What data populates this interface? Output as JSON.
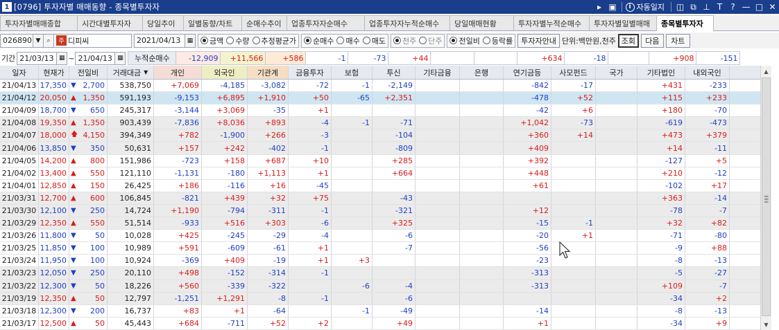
{
  "window": {
    "number": "1",
    "title": "[0796] 투자자별 매매동향 - 종목별투자자",
    "auto_label": "자동일지",
    "info_glyph": "i"
  },
  "tabs": [
    {
      "label": "투자자별매매종합",
      "active": false
    },
    {
      "label": "시간대별투자자",
      "active": false
    },
    {
      "label": "당일추이",
      "active": false
    },
    {
      "label": "일별동향/차트",
      "active": false
    },
    {
      "label": "순매수추이",
      "active": false
    },
    {
      "label": "업종투자자순매수",
      "active": false
    },
    {
      "label": "업종투자자누적순매수",
      "active": false
    },
    {
      "label": "당일매매현황",
      "active": false
    },
    {
      "label": "투자자별누적순매수",
      "active": false
    },
    {
      "label": "투자자별일별매매",
      "active": false
    },
    {
      "label": "종목별투자자",
      "active": true
    }
  ],
  "toolbar": {
    "stock_code": "026890",
    "stock_badge": "주",
    "stock_name": "디피씨",
    "date": "2021/04/13",
    "amount_options": [
      {
        "label": "금액",
        "checked": true
      },
      {
        "label": "수량",
        "checked": false
      },
      {
        "label": "추정평균가",
        "checked": false
      }
    ],
    "trade_options": [
      {
        "label": "순매수",
        "checked": true
      },
      {
        "label": "매수",
        "checked": false
      },
      {
        "label": "매도",
        "checked": false
      }
    ],
    "unit_options": [
      {
        "label": "천주",
        "checked": true
      },
      {
        "label": "단주",
        "checked": false
      }
    ],
    "compare_options": [
      {
        "label": "전일비",
        "checked": true
      },
      {
        "label": "등락률",
        "checked": false
      }
    ],
    "investor_guide_button": "투자자안내",
    "unit_text": "단위:백만원,천주",
    "query_button": "조회",
    "next_button": "다음",
    "chart_button": "차트"
  },
  "period": {
    "label": "기간",
    "from": "21/03/13",
    "tilde": "~",
    "to": "21/04/13",
    "cumulative_label": "누적순매수",
    "totals": [
      "-12,909",
      "+11,566",
      "+586",
      "-1",
      "-73",
      "+44",
      "",
      "",
      "+634",
      "-18",
      "",
      "+908",
      "-151"
    ]
  },
  "columns": [
    "일자",
    "현재가",
    "전일비",
    "거래대금",
    "개인",
    "외국인",
    "기관계",
    "금융투자",
    "보험",
    "투신",
    "기타금융",
    "은행",
    "연기금등",
    "사모펀드",
    "국가",
    "기타법인",
    "내외국인"
  ],
  "rows": [
    {
      "date": "21/04/13",
      "price": "17,350",
      "dir": "down",
      "diff": "2,700",
      "value": "538,750",
      "cells": [
        "+7,069",
        "-4,185",
        "-3,082",
        "-72",
        "-1",
        "-2,149",
        "",
        "",
        "-842",
        "-17",
        "",
        "+431",
        "-233"
      ],
      "bg": "white"
    },
    {
      "date": "21/04/12",
      "price": "20,050",
      "dir": "up",
      "diff": "1,350",
      "value": "591,193",
      "cells": [
        "-9,153",
        "+6,895",
        "+1,910",
        "+50",
        "-65",
        "+2,351",
        "",
        "",
        "-478",
        "+52",
        "",
        "+115",
        "+233"
      ],
      "bg": "sel"
    },
    {
      "date": "21/04/09",
      "price": "18,700",
      "dir": "down",
      "diff": "650",
      "value": "245,317",
      "cells": [
        "-3,144",
        "+3,069",
        "-35",
        "+1",
        "",
        "",
        "",
        "",
        "-42",
        "+6",
        "",
        "+180",
        "-70"
      ],
      "bg": "white"
    },
    {
      "date": "21/04/08",
      "price": "19,350",
      "dir": "up",
      "diff": "1,350",
      "value": "903,439",
      "cells": [
        "-7,836",
        "+8,036",
        "+893",
        "-4",
        "-1",
        "-71",
        "",
        "",
        "+1,042",
        "-73",
        "",
        "-619",
        "-473"
      ],
      "bg": "gray"
    },
    {
      "date": "21/04/07",
      "price": "18,000",
      "dir": "upper",
      "diff": "4,150",
      "value": "394,349",
      "cells": [
        "+782",
        "-1,900",
        "+266",
        "-3",
        "",
        "-104",
        "",
        "",
        "+360",
        "+14",
        "",
        "+473",
        "+379"
      ],
      "bg": "gray"
    },
    {
      "date": "21/04/06",
      "price": "13,850",
      "dir": "down",
      "diff": "350",
      "value": "50,631",
      "cells": [
        "+157",
        "+242",
        "-402",
        "-1",
        "",
        "-809",
        "",
        "",
        "+409",
        "",
        "",
        "+14",
        "-11"
      ],
      "bg": "gray"
    },
    {
      "date": "21/04/05",
      "price": "14,200",
      "dir": "up",
      "diff": "800",
      "value": "151,986",
      "cells": [
        "-723",
        "+158",
        "+687",
        "+10",
        "",
        "+285",
        "",
        "",
        "+392",
        "",
        "",
        "-127",
        "+5"
      ],
      "bg": "white"
    },
    {
      "date": "21/04/02",
      "price": "13,400",
      "dir": "up",
      "diff": "550",
      "value": "121,110",
      "cells": [
        "-1,131",
        "-180",
        "+1,113",
        "+1",
        "",
        "+664",
        "",
        "",
        "+448",
        "",
        "",
        "+210",
        "-12"
      ],
      "bg": "white"
    },
    {
      "date": "21/04/01",
      "price": "12,850",
      "dir": "up",
      "diff": "150",
      "value": "26,425",
      "cells": [
        "+186",
        "-116",
        "+16",
        "-45",
        "",
        "",
        "",
        "",
        "+61",
        "",
        "",
        "-102",
        "+17"
      ],
      "bg": "white"
    },
    {
      "date": "21/03/31",
      "price": "12,700",
      "dir": "up",
      "diff": "600",
      "value": "106,845",
      "cells": [
        "-821",
        "+439",
        "+32",
        "+75",
        "",
        "-43",
        "",
        "",
        "",
        "",
        "",
        "+363",
        "-14"
      ],
      "bg": "gray"
    },
    {
      "date": "21/03/30",
      "price": "12,100",
      "dir": "down",
      "diff": "250",
      "value": "14,724",
      "cells": [
        "+1,190",
        "-794",
        "-311",
        "-1",
        "",
        "-321",
        "",
        "",
        "+12",
        "",
        "",
        "-78",
        "-7"
      ],
      "bg": "gray"
    },
    {
      "date": "21/03/29",
      "price": "12,350",
      "dir": "up",
      "diff": "550",
      "value": "51,514",
      "cells": [
        "-933",
        "+516",
        "+303",
        "-6",
        "",
        "+325",
        "",
        "",
        "-15",
        "-1",
        "",
        "+32",
        "+82"
      ],
      "bg": "gray"
    },
    {
      "date": "21/03/26",
      "price": "11,800",
      "dir": "down",
      "diff": "50",
      "value": "10,028",
      "cells": [
        "+425",
        "-245",
        "-29",
        "-4",
        "",
        "-6",
        "",
        "",
        "-20",
        "+1",
        "",
        "-71",
        "-80"
      ],
      "bg": "white"
    },
    {
      "date": "21/03/25",
      "price": "11,850",
      "dir": "down",
      "diff": "100",
      "value": "10,989",
      "cells": [
        "+591",
        "-609",
        "-61",
        "+1",
        "",
        "-7",
        "",
        "",
        "-56",
        "",
        "",
        "-9",
        "+88"
      ],
      "bg": "white"
    },
    {
      "date": "21/03/24",
      "price": "11,950",
      "dir": "down",
      "diff": "100",
      "value": "10,924",
      "cells": [
        "-369",
        "+409",
        "-19",
        "+1",
        "+3",
        "",
        "",
        "",
        "-23",
        "",
        "",
        "-8",
        "-13"
      ],
      "bg": "white"
    },
    {
      "date": "21/03/23",
      "price": "12,050",
      "dir": "down",
      "diff": "250",
      "value": "20,110",
      "cells": [
        "+498",
        "-152",
        "-314",
        "-1",
        "",
        "",
        "",
        "",
        "-313",
        "",
        "",
        "-5",
        "-27"
      ],
      "bg": "gray"
    },
    {
      "date": "21/03/22",
      "price": "12,300",
      "dir": "down",
      "diff": "50",
      "value": "18,226",
      "cells": [
        "+560",
        "-339",
        "-322",
        "",
        "-6",
        "-4",
        "",
        "",
        "-313",
        "",
        "",
        "+109",
        "-7"
      ],
      "bg": "gray"
    },
    {
      "date": "21/03/19",
      "price": "12,350",
      "dir": "up",
      "diff": "50",
      "value": "12,797",
      "cells": [
        "-1,251",
        "+1,291",
        "-8",
        "-1",
        "",
        "-6",
        "",
        "",
        "",
        "",
        "",
        "-34",
        "+2"
      ],
      "bg": "gray"
    },
    {
      "date": "21/03/18",
      "price": "12,300",
      "dir": "down",
      "diff": "200",
      "value": "16,737",
      "cells": [
        "+83",
        "+1",
        "-64",
        "",
        "-1",
        "-49",
        "",
        "",
        "-14",
        "",
        "",
        "-8",
        "-13"
      ],
      "bg": "white"
    },
    {
      "date": "21/03/17",
      "price": "12,500",
      "dir": "up",
      "diff": "50",
      "value": "45,443",
      "cells": [
        "+684",
        "-711",
        "+52",
        "+2",
        "",
        "+49",
        "",
        "",
        "+1",
        "",
        "",
        "-34",
        "+9"
      ],
      "bg": "white"
    }
  ],
  "colors": {
    "up": "#d81b1b",
    "down": "#1f3fc4",
    "title_bar": "#1a3e8c",
    "selected_row": "#cfe6f2"
  },
  "icons": {
    "down": "▼",
    "up": "▲",
    "upper": "🡅"
  }
}
